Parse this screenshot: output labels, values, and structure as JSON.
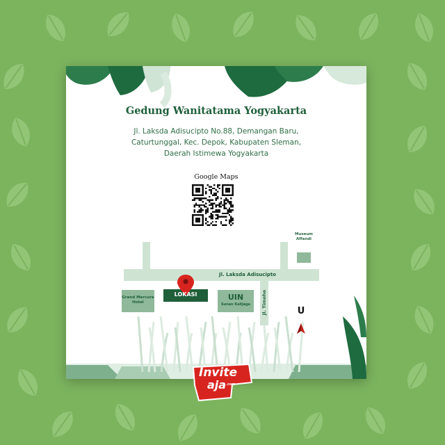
{
  "venue": {
    "title": "Gedung Wanitatama Yogyakarta",
    "address_lines": [
      "Jl. Laksda Adisucipto No.88, Demangan Baru,",
      "Caturtunggal, Kec. Depok, Kabupaten Sleman,",
      "Daerah Istimewa Yogyakarta"
    ]
  },
  "qr": {
    "label": "Google Maps"
  },
  "map": {
    "road_main": "Jl. Laksda Adisucipto",
    "road_side": "Jl. Timoho",
    "museum": [
      "Museum",
      "Affandi"
    ],
    "hotel": [
      "Grand Mercure",
      "Hotel"
    ],
    "location": "LOKASI",
    "campus": "UIN",
    "campus_sub": "Sunan Kalijaga",
    "compass": "U"
  },
  "brand": {
    "line1": "Invite",
    "line2": "aja",
    "suffix": ".com"
  },
  "colors": {
    "background": "#7cb45e",
    "dark_green": "#1f5f3a",
    "map_green": "#cfe3d3",
    "block_green": "#8fb99a",
    "pin_red": "#d8241f"
  }
}
